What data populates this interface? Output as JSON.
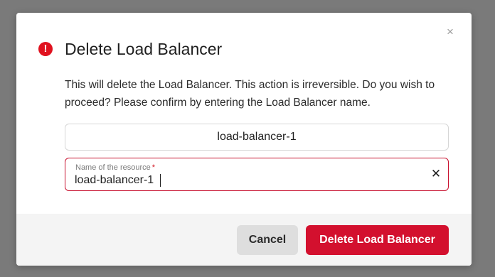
{
  "dialog": {
    "title": "Delete Load Balancer",
    "alert_icon_glyph": "!",
    "close_glyph": "×",
    "description": "This will delete the Load Balancer. This action is irreversible. Do you wish to proceed? Please confirm by entering the Load Balancer name.",
    "resource_name": "load-balancer-1"
  },
  "input": {
    "label": "Name of the resource",
    "required_mark": "*",
    "value": "load-balancer-1",
    "clear_glyph": "✕"
  },
  "footer": {
    "cancel_label": "Cancel",
    "delete_label": "Delete Load Balancer"
  },
  "colors": {
    "accent_red": "#d3102e",
    "backdrop": "#7a7a7a",
    "footer_bg": "#f4f4f4"
  },
  "icons": {
    "alert": "alert-circle-icon",
    "close": "close-icon",
    "clear": "clear-icon"
  }
}
